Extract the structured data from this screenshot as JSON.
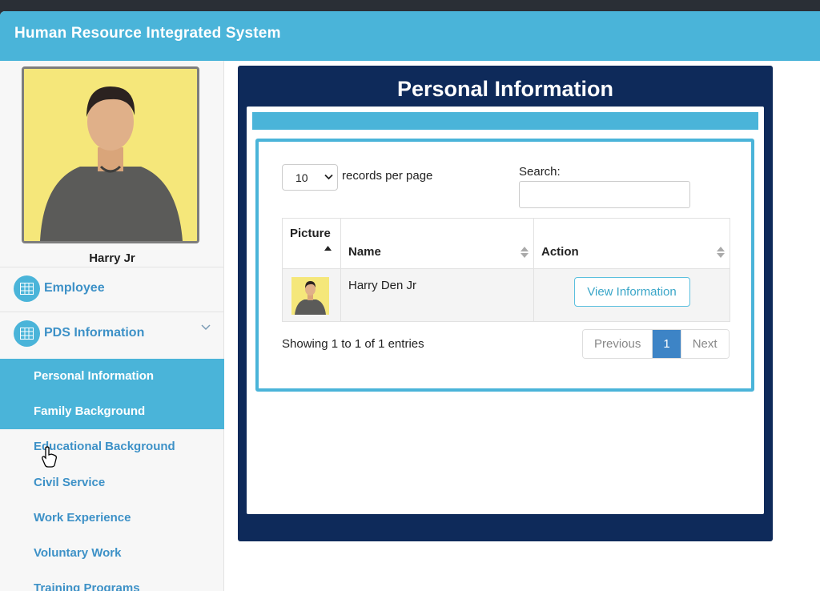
{
  "app": {
    "title": "Human Resource Integrated System"
  },
  "sidebar": {
    "user_name": "Harry Jr",
    "menu": [
      {
        "label": "Employee",
        "icon": "table-icon"
      },
      {
        "label": "PDS Information",
        "icon": "table-icon"
      }
    ],
    "submenu": [
      {
        "label": "Personal Information",
        "active": true
      },
      {
        "label": "Family Background",
        "active": true
      },
      {
        "label": "Educational Background",
        "active": false
      },
      {
        "label": "Civil Service",
        "active": false
      },
      {
        "label": "Work Experience",
        "active": false
      },
      {
        "label": "Voluntary Work",
        "active": false
      },
      {
        "label": "Training Programs",
        "active": false
      }
    ]
  },
  "main": {
    "title": "Personal Information",
    "length_menu": {
      "value": "10",
      "suffix": "records per page"
    },
    "search": {
      "label": "Search:",
      "value": ""
    },
    "table": {
      "columns": [
        "Picture",
        "Name",
        "Action"
      ],
      "rows": [
        {
          "name": "Harry Den Jr",
          "action": "View Information"
        }
      ]
    },
    "info": "Showing 1 to 1 of 1 entries",
    "pagination": {
      "previous": "Previous",
      "current": "1",
      "next": "Next"
    }
  },
  "colors": {
    "accent": "#4ab4d9",
    "panel": "#0e2a5a",
    "link": "#3d91c7",
    "page_active": "#3d84c6"
  }
}
